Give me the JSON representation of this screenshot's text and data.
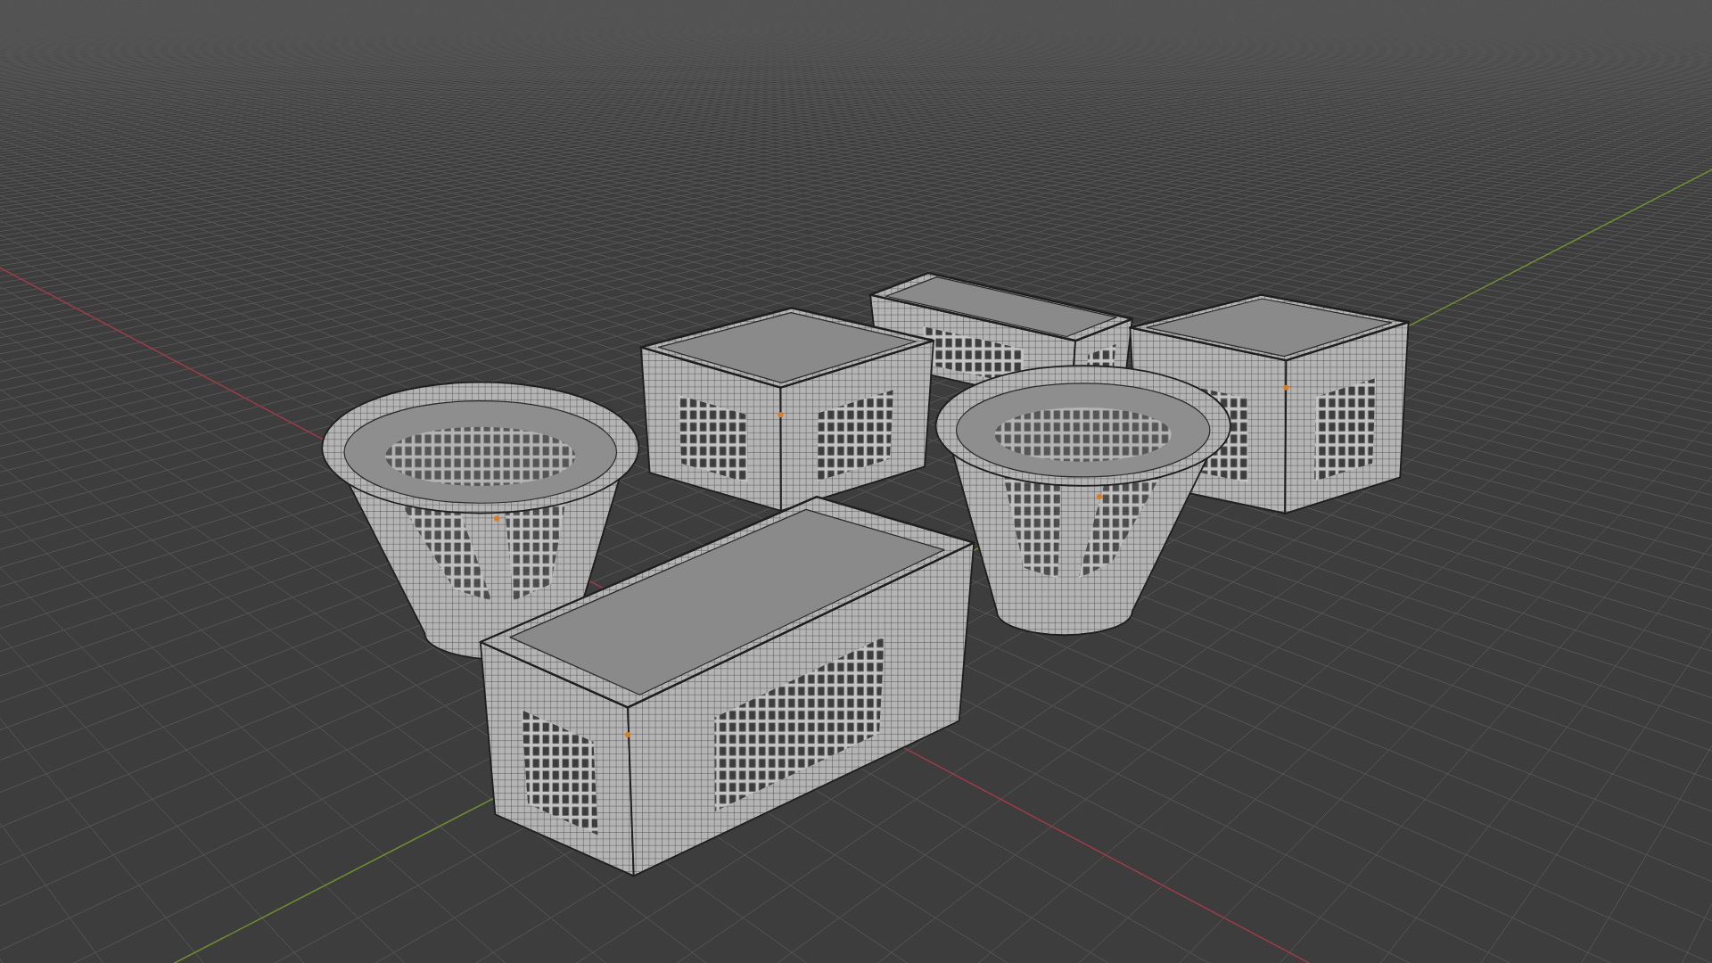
{
  "viewport": {
    "objects": [
      {
        "kind": "oblong"
      },
      {
        "kind": "square"
      },
      {
        "kind": "square"
      },
      {
        "kind": "round"
      },
      {
        "kind": "round"
      },
      {
        "kind": "oblong"
      }
    ]
  }
}
